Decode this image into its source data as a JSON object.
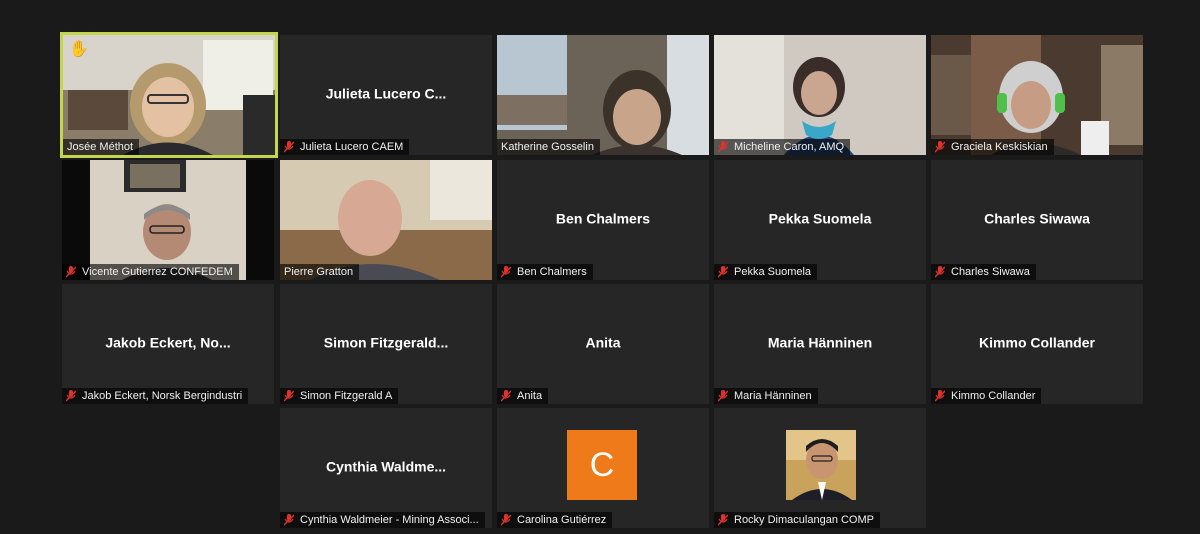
{
  "participants": [
    {
      "label": "Josée Méthot",
      "muted": false,
      "hand_raised": true
    },
    {
      "label": "Julieta Lucero CAEM",
      "display_name": "Julieta Lucero C...",
      "muted": true
    },
    {
      "label": "Katherine Gosselin",
      "muted": false
    },
    {
      "label": "Micheline Caron, AMQ",
      "muted": true
    },
    {
      "label": "Graciela Keskiskian",
      "muted": true
    },
    {
      "label": "Vicente Gutierrez CONFEDEM",
      "muted": true
    },
    {
      "label": "Pierre Gratton",
      "muted": false
    },
    {
      "label": "Ben Chalmers",
      "display_name": "Ben Chalmers",
      "muted": true
    },
    {
      "label": "Pekka Suomela",
      "display_name": "Pekka Suomela",
      "muted": true
    },
    {
      "label": "Charles Siwawa",
      "display_name": "Charles Siwawa",
      "muted": true
    },
    {
      "label": "Jakob Eckert, Norsk Bergindustri",
      "display_name": "Jakob Eckert, No...",
      "muted": true
    },
    {
      "label": "Simon Fitzgerald A",
      "display_name": "Simon  Fitzgerald...",
      "muted": true
    },
    {
      "label": "Anita",
      "display_name": "Anita",
      "muted": true
    },
    {
      "label": "Maria Hänninen",
      "display_name": "Maria Hänninen",
      "muted": true
    },
    {
      "label": "Kimmo Collander",
      "display_name": "Kimmo Collander",
      "muted": true
    },
    {
      "label": "Cynthia Waldmeier - Mining Associ...",
      "display_name": "Cynthia  Waldme...",
      "muted": true
    },
    {
      "label": "Carolina Gutiérrez",
      "avatar_letter": "C",
      "muted": true
    },
    {
      "label": "Rocky Dimaculangan COMP",
      "muted": true
    }
  ],
  "colors": {
    "background": "#1a1a1a",
    "tile": "#262626",
    "active_speaker_border": "#c3d64f",
    "muted_mic": "#e0322c",
    "avatar_orange": "#ee7a1a"
  },
  "icons": {
    "muted": "microphone-muted-icon",
    "hand": "raised-hand-icon"
  }
}
